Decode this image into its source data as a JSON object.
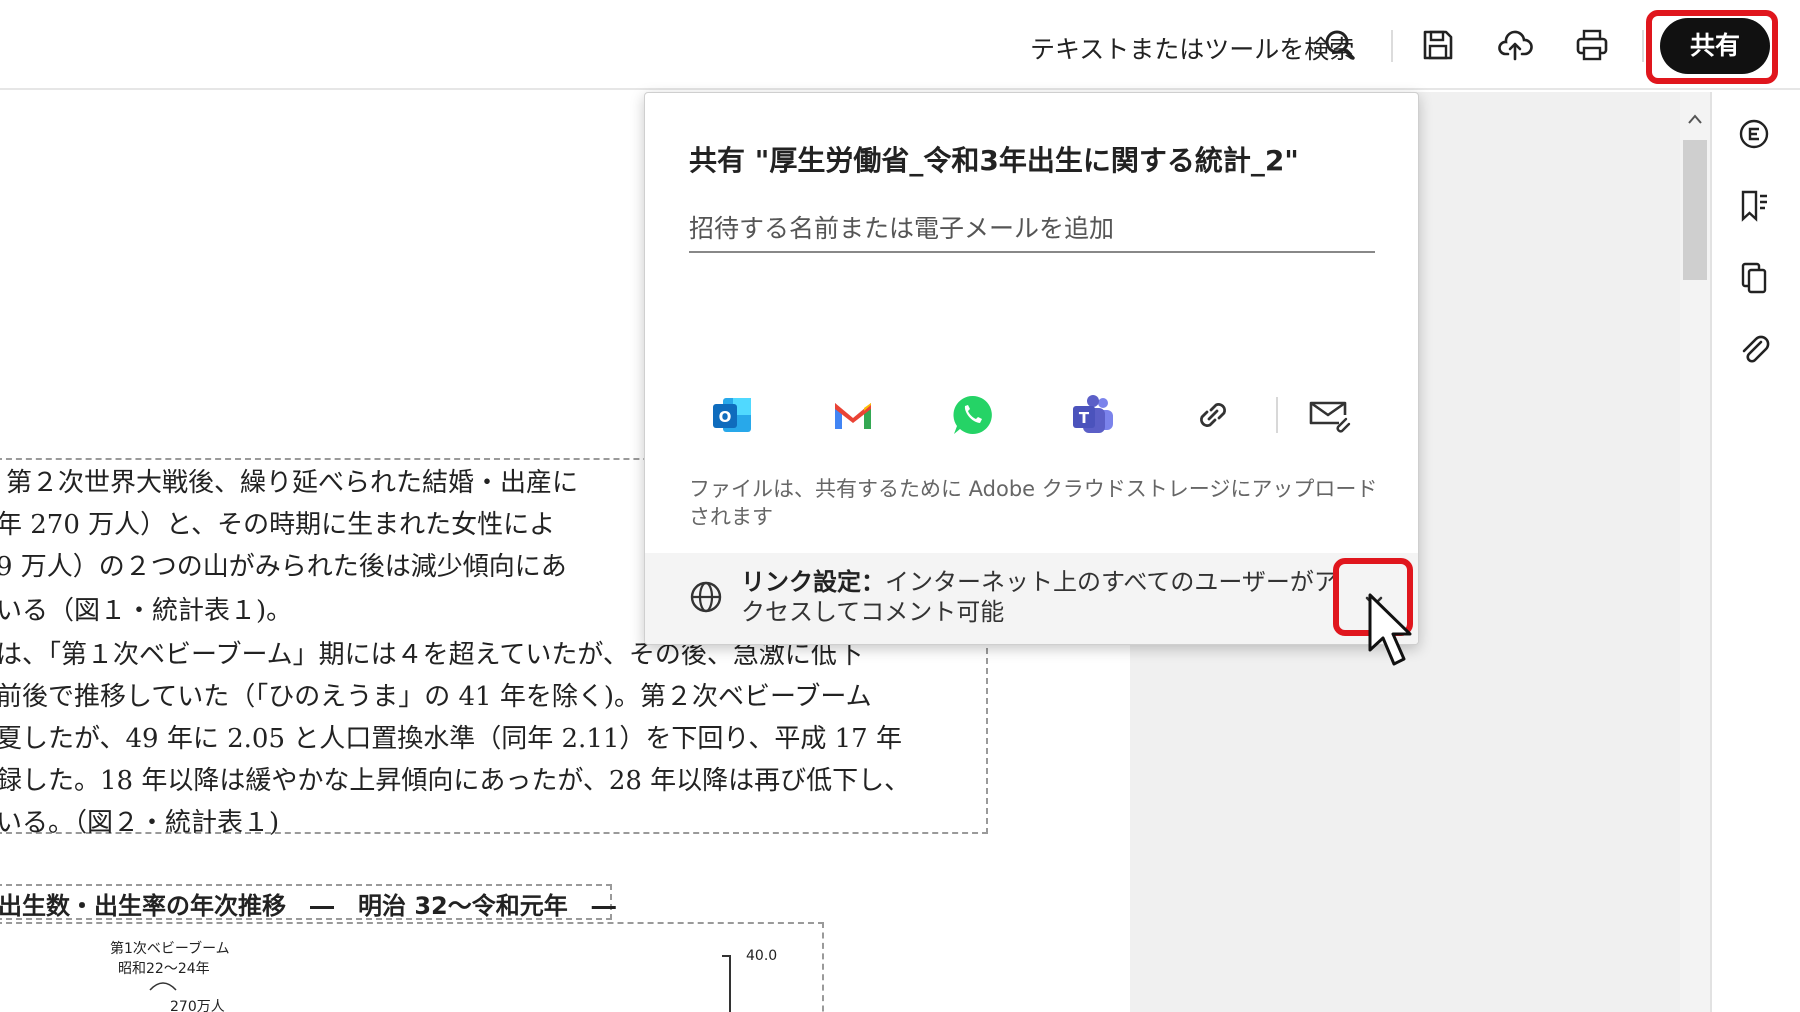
{
  "toolbar": {
    "search_label": "テキストまたはツールを検索",
    "share_label": "共有"
  },
  "dialog": {
    "title": "共有 \"厚生労働省_令和3年出生に関する統計_2\"",
    "invite_placeholder": "招待する名前または電子メールを追加",
    "services": [
      "outlook-icon",
      "gmail-icon",
      "whatsapp-icon",
      "teams-icon",
      "copy-link-icon",
      "email-icon"
    ],
    "upload_note": "ファイルは、共有するために Adobe クラウドストレージにアップロードされます",
    "link_settings_label": "リンク設定：",
    "link_settings_value": "インターネット上のすべてのユーザーがアクセスしてコメント可能"
  },
  "document": {
    "lines": [
      "第２次世界大戦後、繰り延べられた結婚・出産に",
      "年 270 万人）と、その時期に生まれた女性によ",
      "9 万人）の２つの山がみられた後は減少傾向にあ",
      "いる（図１・統計表１)。",
      "は、「第１次ベビーブーム」期には４を超えていたが、その後、急激に低下",
      "前後で推移していた（「ひのえうま」の 41 年を除く)。第２次ベビーブーム",
      "夏したが、49 年に 2.05 と人口置換水準（同年 2.11）を下回り、平成 17 年",
      "録した。18 年以降は緩やかな上昇傾向にあったが、28 年以降は再び低下し、",
      "いる。（図２・統計表１)"
    ],
    "figure_title": "出生数・出生率の年次推移　―　明治 32～令和元年　―",
    "chart_annotation_1": "第1次ベビーブーム",
    "chart_annotation_2": "昭和22～24年",
    "chart_annotation_3": "270万人",
    "chart_axis_top": "40.0"
  },
  "colors": {
    "highlight": "#e0161d",
    "share_button": "#111111",
    "outlook": "#0f6cbd",
    "whatsapp": "#25d366",
    "teams": "#5b5fc7"
  }
}
